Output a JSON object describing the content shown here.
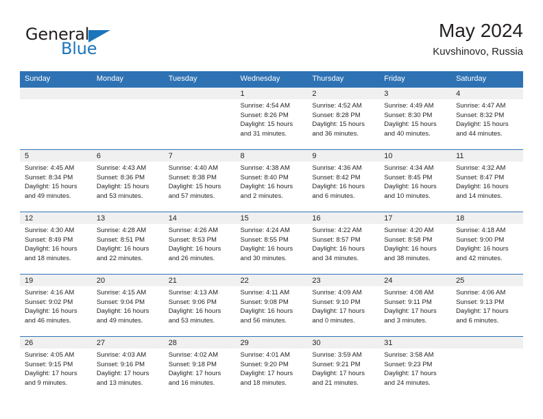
{
  "brand": {
    "name_part1": "General",
    "name_part2": "Blue",
    "triangle_color": "#1b75bb"
  },
  "header": {
    "title": "May 2024",
    "subtitle": "Kuvshinovo, Russia"
  },
  "theme": {
    "header_blue": "#2e72b4",
    "daynum_band": "#f0f0f0",
    "text": "#231f20"
  },
  "weekdays": [
    "Sunday",
    "Monday",
    "Tuesday",
    "Wednesday",
    "Thursday",
    "Friday",
    "Saturday"
  ],
  "weeks": [
    [
      {
        "day": "",
        "empty": true,
        "lines": []
      },
      {
        "day": "",
        "empty": true,
        "lines": []
      },
      {
        "day": "",
        "empty": true,
        "lines": []
      },
      {
        "day": "1",
        "lines": [
          "Sunrise: 4:54 AM",
          "Sunset: 8:26 PM",
          "Daylight: 15 hours",
          "and 31 minutes."
        ]
      },
      {
        "day": "2",
        "lines": [
          "Sunrise: 4:52 AM",
          "Sunset: 8:28 PM",
          "Daylight: 15 hours",
          "and 36 minutes."
        ]
      },
      {
        "day": "3",
        "lines": [
          "Sunrise: 4:49 AM",
          "Sunset: 8:30 PM",
          "Daylight: 15 hours",
          "and 40 minutes."
        ]
      },
      {
        "day": "4",
        "lines": [
          "Sunrise: 4:47 AM",
          "Sunset: 8:32 PM",
          "Daylight: 15 hours",
          "and 44 minutes."
        ]
      }
    ],
    [
      {
        "day": "5",
        "lines": [
          "Sunrise: 4:45 AM",
          "Sunset: 8:34 PM",
          "Daylight: 15 hours",
          "and 49 minutes."
        ]
      },
      {
        "day": "6",
        "lines": [
          "Sunrise: 4:43 AM",
          "Sunset: 8:36 PM",
          "Daylight: 15 hours",
          "and 53 minutes."
        ]
      },
      {
        "day": "7",
        "lines": [
          "Sunrise: 4:40 AM",
          "Sunset: 8:38 PM",
          "Daylight: 15 hours",
          "and 57 minutes."
        ]
      },
      {
        "day": "8",
        "lines": [
          "Sunrise: 4:38 AM",
          "Sunset: 8:40 PM",
          "Daylight: 16 hours",
          "and 2 minutes."
        ]
      },
      {
        "day": "9",
        "lines": [
          "Sunrise: 4:36 AM",
          "Sunset: 8:42 PM",
          "Daylight: 16 hours",
          "and 6 minutes."
        ]
      },
      {
        "day": "10",
        "lines": [
          "Sunrise: 4:34 AM",
          "Sunset: 8:45 PM",
          "Daylight: 16 hours",
          "and 10 minutes."
        ]
      },
      {
        "day": "11",
        "lines": [
          "Sunrise: 4:32 AM",
          "Sunset: 8:47 PM",
          "Daylight: 16 hours",
          "and 14 minutes."
        ]
      }
    ],
    [
      {
        "day": "12",
        "lines": [
          "Sunrise: 4:30 AM",
          "Sunset: 8:49 PM",
          "Daylight: 16 hours",
          "and 18 minutes."
        ]
      },
      {
        "day": "13",
        "lines": [
          "Sunrise: 4:28 AM",
          "Sunset: 8:51 PM",
          "Daylight: 16 hours",
          "and 22 minutes."
        ]
      },
      {
        "day": "14",
        "lines": [
          "Sunrise: 4:26 AM",
          "Sunset: 8:53 PM",
          "Daylight: 16 hours",
          "and 26 minutes."
        ]
      },
      {
        "day": "15",
        "lines": [
          "Sunrise: 4:24 AM",
          "Sunset: 8:55 PM",
          "Daylight: 16 hours",
          "and 30 minutes."
        ]
      },
      {
        "day": "16",
        "lines": [
          "Sunrise: 4:22 AM",
          "Sunset: 8:57 PM",
          "Daylight: 16 hours",
          "and 34 minutes."
        ]
      },
      {
        "day": "17",
        "lines": [
          "Sunrise: 4:20 AM",
          "Sunset: 8:58 PM",
          "Daylight: 16 hours",
          "and 38 minutes."
        ]
      },
      {
        "day": "18",
        "lines": [
          "Sunrise: 4:18 AM",
          "Sunset: 9:00 PM",
          "Daylight: 16 hours",
          "and 42 minutes."
        ]
      }
    ],
    [
      {
        "day": "19",
        "lines": [
          "Sunrise: 4:16 AM",
          "Sunset: 9:02 PM",
          "Daylight: 16 hours",
          "and 46 minutes."
        ]
      },
      {
        "day": "20",
        "lines": [
          "Sunrise: 4:15 AM",
          "Sunset: 9:04 PM",
          "Daylight: 16 hours",
          "and 49 minutes."
        ]
      },
      {
        "day": "21",
        "lines": [
          "Sunrise: 4:13 AM",
          "Sunset: 9:06 PM",
          "Daylight: 16 hours",
          "and 53 minutes."
        ]
      },
      {
        "day": "22",
        "lines": [
          "Sunrise: 4:11 AM",
          "Sunset: 9:08 PM",
          "Daylight: 16 hours",
          "and 56 minutes."
        ]
      },
      {
        "day": "23",
        "lines": [
          "Sunrise: 4:09 AM",
          "Sunset: 9:10 PM",
          "Daylight: 17 hours",
          "and 0 minutes."
        ]
      },
      {
        "day": "24",
        "lines": [
          "Sunrise: 4:08 AM",
          "Sunset: 9:11 PM",
          "Daylight: 17 hours",
          "and 3 minutes."
        ]
      },
      {
        "day": "25",
        "lines": [
          "Sunrise: 4:06 AM",
          "Sunset: 9:13 PM",
          "Daylight: 17 hours",
          "and 6 minutes."
        ]
      }
    ],
    [
      {
        "day": "26",
        "lines": [
          "Sunrise: 4:05 AM",
          "Sunset: 9:15 PM",
          "Daylight: 17 hours",
          "and 9 minutes."
        ]
      },
      {
        "day": "27",
        "lines": [
          "Sunrise: 4:03 AM",
          "Sunset: 9:16 PM",
          "Daylight: 17 hours",
          "and 13 minutes."
        ]
      },
      {
        "day": "28",
        "lines": [
          "Sunrise: 4:02 AM",
          "Sunset: 9:18 PM",
          "Daylight: 17 hours",
          "and 16 minutes."
        ]
      },
      {
        "day": "29",
        "lines": [
          "Sunrise: 4:01 AM",
          "Sunset: 9:20 PM",
          "Daylight: 17 hours",
          "and 18 minutes."
        ]
      },
      {
        "day": "30",
        "lines": [
          "Sunrise: 3:59 AM",
          "Sunset: 9:21 PM",
          "Daylight: 17 hours",
          "and 21 minutes."
        ]
      },
      {
        "day": "31",
        "lines": [
          "Sunrise: 3:58 AM",
          "Sunset: 9:23 PM",
          "Daylight: 17 hours",
          "and 24 minutes."
        ]
      },
      {
        "day": "",
        "empty": true,
        "lines": []
      }
    ]
  ]
}
